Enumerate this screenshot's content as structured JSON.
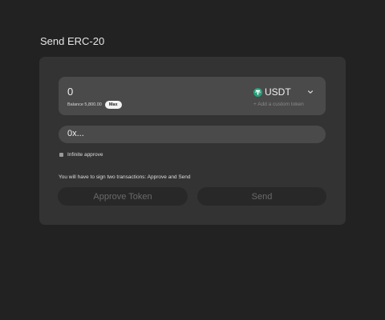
{
  "page": {
    "title": "Send ERC-20"
  },
  "amount": {
    "value": "0",
    "balance_label": "Balance 5,800.00",
    "max_label": "Max"
  },
  "token": {
    "symbol": "USDT",
    "icon": "usdt-icon",
    "icon_color": "#26a17b",
    "add_custom_label": "+ Add a custom token"
  },
  "recipient": {
    "placeholder": "0x..."
  },
  "infinite_approve": {
    "label": "Infinite approve",
    "checked": false
  },
  "notice": "You will have to sign two transactions: Approve and Send",
  "actions": {
    "approve_label": "Approve Token",
    "send_label": "Send"
  }
}
